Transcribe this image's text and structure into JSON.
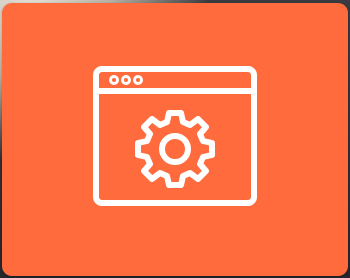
{
  "background": {
    "tile_color": "#FF6B3D",
    "icon_color": "#FFFFFF"
  },
  "icon": {
    "name": "browser-settings-icon",
    "description_parts": [
      "browser-window-icon",
      "gear-icon"
    ]
  }
}
